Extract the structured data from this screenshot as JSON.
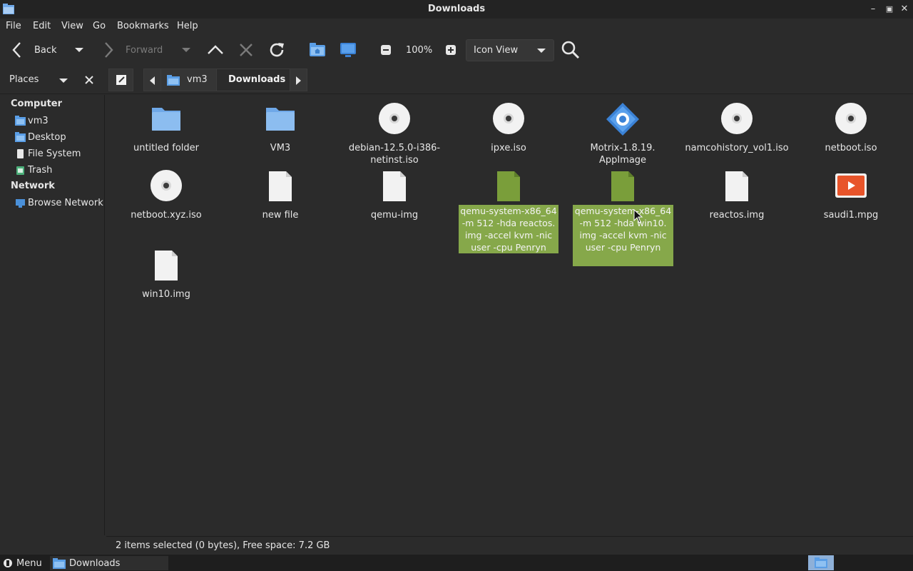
{
  "window": {
    "title": "Downloads"
  },
  "menubar": {
    "items": [
      "File",
      "Edit",
      "View",
      "Go",
      "Bookmarks",
      "Help"
    ]
  },
  "toolbar": {
    "back_label": "Back",
    "forward_label": "Forward",
    "zoom": "100%",
    "view_mode": "Icon View"
  },
  "location": {
    "places_label": "Places",
    "crumbs": [
      "vm3",
      "Downloads"
    ]
  },
  "sidebar": {
    "computer_header": "Computer",
    "computer_items": [
      "vm3",
      "Desktop",
      "File System",
      "Trash"
    ],
    "network_header": "Network",
    "network_items": [
      "Browse Network"
    ]
  },
  "files": [
    {
      "name": "untitled folder",
      "type": "folder"
    },
    {
      "name": "VM3",
      "type": "folder"
    },
    {
      "name": "debian-12.5.0-i386-netinst.iso",
      "line1": "debian-12.5.0-i386-",
      "line2": "netinst.iso",
      "type": "disc"
    },
    {
      "name": "ipxe.iso",
      "type": "disc"
    },
    {
      "name": "Motrix-1.8.19.AppImage",
      "line1": "Motrix-1.8.19.",
      "line2": "AppImage",
      "type": "app"
    },
    {
      "name": "namcohistory_vol1.iso",
      "type": "disc"
    },
    {
      "name": "netboot.iso",
      "type": "disc"
    },
    {
      "name": "netboot.xyz.iso",
      "type": "disc"
    },
    {
      "name": "new file",
      "type": "doc"
    },
    {
      "name": "qemu-img",
      "type": "doc"
    },
    {
      "name": "qemu-system-x86_64 -m 512 -hda reactos.img -accel kvm -nic user -cpu Penryn",
      "lines": [
        "qemu-system-x86_64",
        "-m 512 -hda reactos.",
        "img -accel kvm -nic",
        "user -cpu Penryn"
      ],
      "type": "script",
      "selected": true
    },
    {
      "name": "qemu-system-x86_64 -m 512 -hda win10.img -accel kvm -nic user -cpu Penryn",
      "lines": [
        "qemu-system-x86_64",
        "-m 512 -hda win10.",
        "img -accel kvm -nic",
        "user -cpu Penryn"
      ],
      "type": "script",
      "selected": true
    },
    {
      "name": "reactos.img",
      "type": "doc"
    },
    {
      "name": "saudi1.mpg",
      "type": "video"
    },
    {
      "name": "win10.img",
      "type": "doc"
    }
  ],
  "status": {
    "text": "2 items selected (0 bytes), Free space: 7.2 GB"
  },
  "taskbar": {
    "menu_label": "Menu",
    "task_label": "Downloads"
  },
  "colors": {
    "selection": "#86a84a",
    "folder": "#6fa8e8",
    "accent": "#4a90d9"
  }
}
